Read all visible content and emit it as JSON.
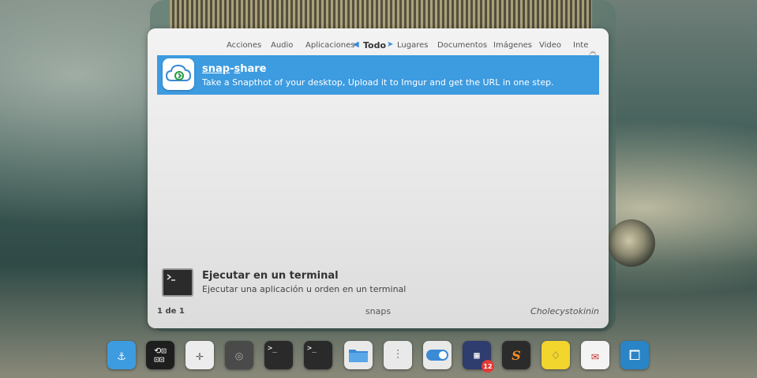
{
  "categories": [
    {
      "label": "Acciones"
    },
    {
      "label": "Audio"
    },
    {
      "label": "Aplicaciones"
    },
    {
      "label": "Todo",
      "active": true
    },
    {
      "label": "Lugares"
    },
    {
      "label": "Documentos"
    },
    {
      "label": "Imágenes"
    },
    {
      "label": "Video"
    },
    {
      "label": "Inte"
    }
  ],
  "nav": {
    "prev": "◀",
    "next": "➤"
  },
  "result": {
    "title_part1": "snap",
    "title_sep": "-",
    "title_part2": "s",
    "title_rest": "hare",
    "description": "Take a Snapthot of your desktop, Upload it to Imgur and get the URL in one step."
  },
  "action": {
    "title": "Ejecutar en un terminal",
    "description": "Ejecutar una aplicación u orden en un terminal"
  },
  "footer": {
    "count": "1 de 1",
    "query": "snaps",
    "user": "Cholecystokinin"
  },
  "dock": [
    {
      "name": "docky-anchor-icon",
      "color": "#3d9be0"
    },
    {
      "name": "settings-grid-icon",
      "color": "#1e1e1e"
    },
    {
      "name": "system-settings-icon",
      "color": "#ececec"
    },
    {
      "name": "disk-utility-icon",
      "color": "#4a4a4a"
    },
    {
      "name": "terminal-icon",
      "color": "#2a2a2a"
    },
    {
      "name": "terminal-alt-icon",
      "color": "#2a2a2a"
    },
    {
      "name": "files-folder-icon",
      "color": "#e9e9e9"
    },
    {
      "name": "mixer-icon",
      "color": "#e9e9e9"
    },
    {
      "name": "toggle-switch-icon",
      "color": "#e9e9e9"
    },
    {
      "name": "app-grid-icon",
      "color": "#2f3c6e",
      "badge": "12"
    },
    {
      "name": "sublime-text-icon",
      "color": "#2b2b2b"
    },
    {
      "name": "idea-bulb-icon",
      "color": "#f2d52d"
    },
    {
      "name": "mail-icon",
      "color": "#f3f3f3"
    },
    {
      "name": "brackets-icon",
      "color": "#2a85c7"
    }
  ]
}
